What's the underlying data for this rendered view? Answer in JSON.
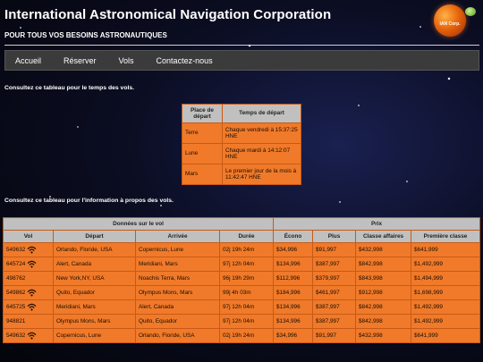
{
  "header": {
    "title": "International Astronomical Navigation Corporation",
    "subtitle": "POUR TOUS VOS BESOINS ASTRONAUTIQUES",
    "logo_text": "IAN Corp."
  },
  "nav": {
    "items": [
      "Accueil",
      "Réserver",
      "Vols",
      "Contactez-nous"
    ]
  },
  "departures": {
    "caption": "Consultez ce tableau pour le temps des vols.",
    "headers": [
      "Place de départ",
      "Temps de départ"
    ],
    "rows": [
      {
        "place": "Terre",
        "time": "Chaque vendredi à 15:37:25 HNE"
      },
      {
        "place": "Lune",
        "time": "Chaque mardi à 14:12:07 HNE"
      },
      {
        "place": "Mars",
        "time": "Le premier jour de la mois à 11:42:47 HNE"
      }
    ]
  },
  "flights": {
    "caption": "Consultez ce tableau pour l'information à propos des vols.",
    "group_headers": [
      "Données sur le vol",
      "Prix"
    ],
    "headers": [
      "Vol",
      "Départ",
      "Arrivée",
      "Durée",
      "Écono",
      "Plus",
      "Classe affaires",
      "Première classe"
    ],
    "rows": [
      {
        "vol": "549632",
        "wifi": true,
        "depart": "Orlando, Floride, USA",
        "arrivee": "Copernicus, Lune",
        "duree": "02j 19h 24m",
        "econo": "$34,996",
        "plus": "$91,997",
        "affaires": "$432,998",
        "premiere": "$641,999"
      },
      {
        "vol": "645724",
        "wifi": true,
        "depart": "Alert, Canada",
        "arrivee": "Meridiani, Mars",
        "duree": "97j 12h 04m",
        "econo": "$134,996",
        "plus": "$387,997",
        "affaires": "$842,998",
        "premiere": "$1,492,999"
      },
      {
        "vol": "498762",
        "wifi": false,
        "depart": "New York,NY, USA",
        "arrivee": "Noachis Terra, Mars",
        "duree": "96j 19h 29m",
        "econo": "$112,996",
        "plus": "$379,997",
        "affaires": "$843,998",
        "premiere": "$1,494,999"
      },
      {
        "vol": "549862",
        "wifi": true,
        "depart": "Quito, Equador",
        "arrivee": "Olympus Mons, Mars",
        "duree": "99j 4h 03m",
        "econo": "$184,996",
        "plus": "$461,997",
        "affaires": "$912,998",
        "premiere": "$1,698,999"
      },
      {
        "vol": "645725",
        "wifi": true,
        "depart": "Meridiani, Mars",
        "arrivee": "Alert, Canada",
        "duree": "97j 12h 04m",
        "econo": "$134,996",
        "plus": "$387,997",
        "affaires": "$842,998",
        "premiere": "$1,492,999"
      },
      {
        "vol": "948821",
        "wifi": false,
        "depart": "Olympus Mons, Mars",
        "arrivee": "Quito, Equador",
        "duree": "97j 12h 04m",
        "econo": "$134,996",
        "plus": "$387,997",
        "affaires": "$842,998",
        "premiere": "$1,492,999"
      },
      {
        "vol": "549632",
        "wifi": true,
        "depart": "Copernicus, Lune",
        "arrivee": "Orlando, Floride, USA",
        "duree": "02j 19h 24m",
        "econo": "$34,996",
        "plus": "$91,997",
        "affaires": "$432,998",
        "premiere": "$641,999"
      }
    ]
  },
  "colors": {
    "cell_orange": "#f07a2a",
    "header_grey": "#bfc0bf",
    "nav_bar": "#3b3b3b"
  }
}
